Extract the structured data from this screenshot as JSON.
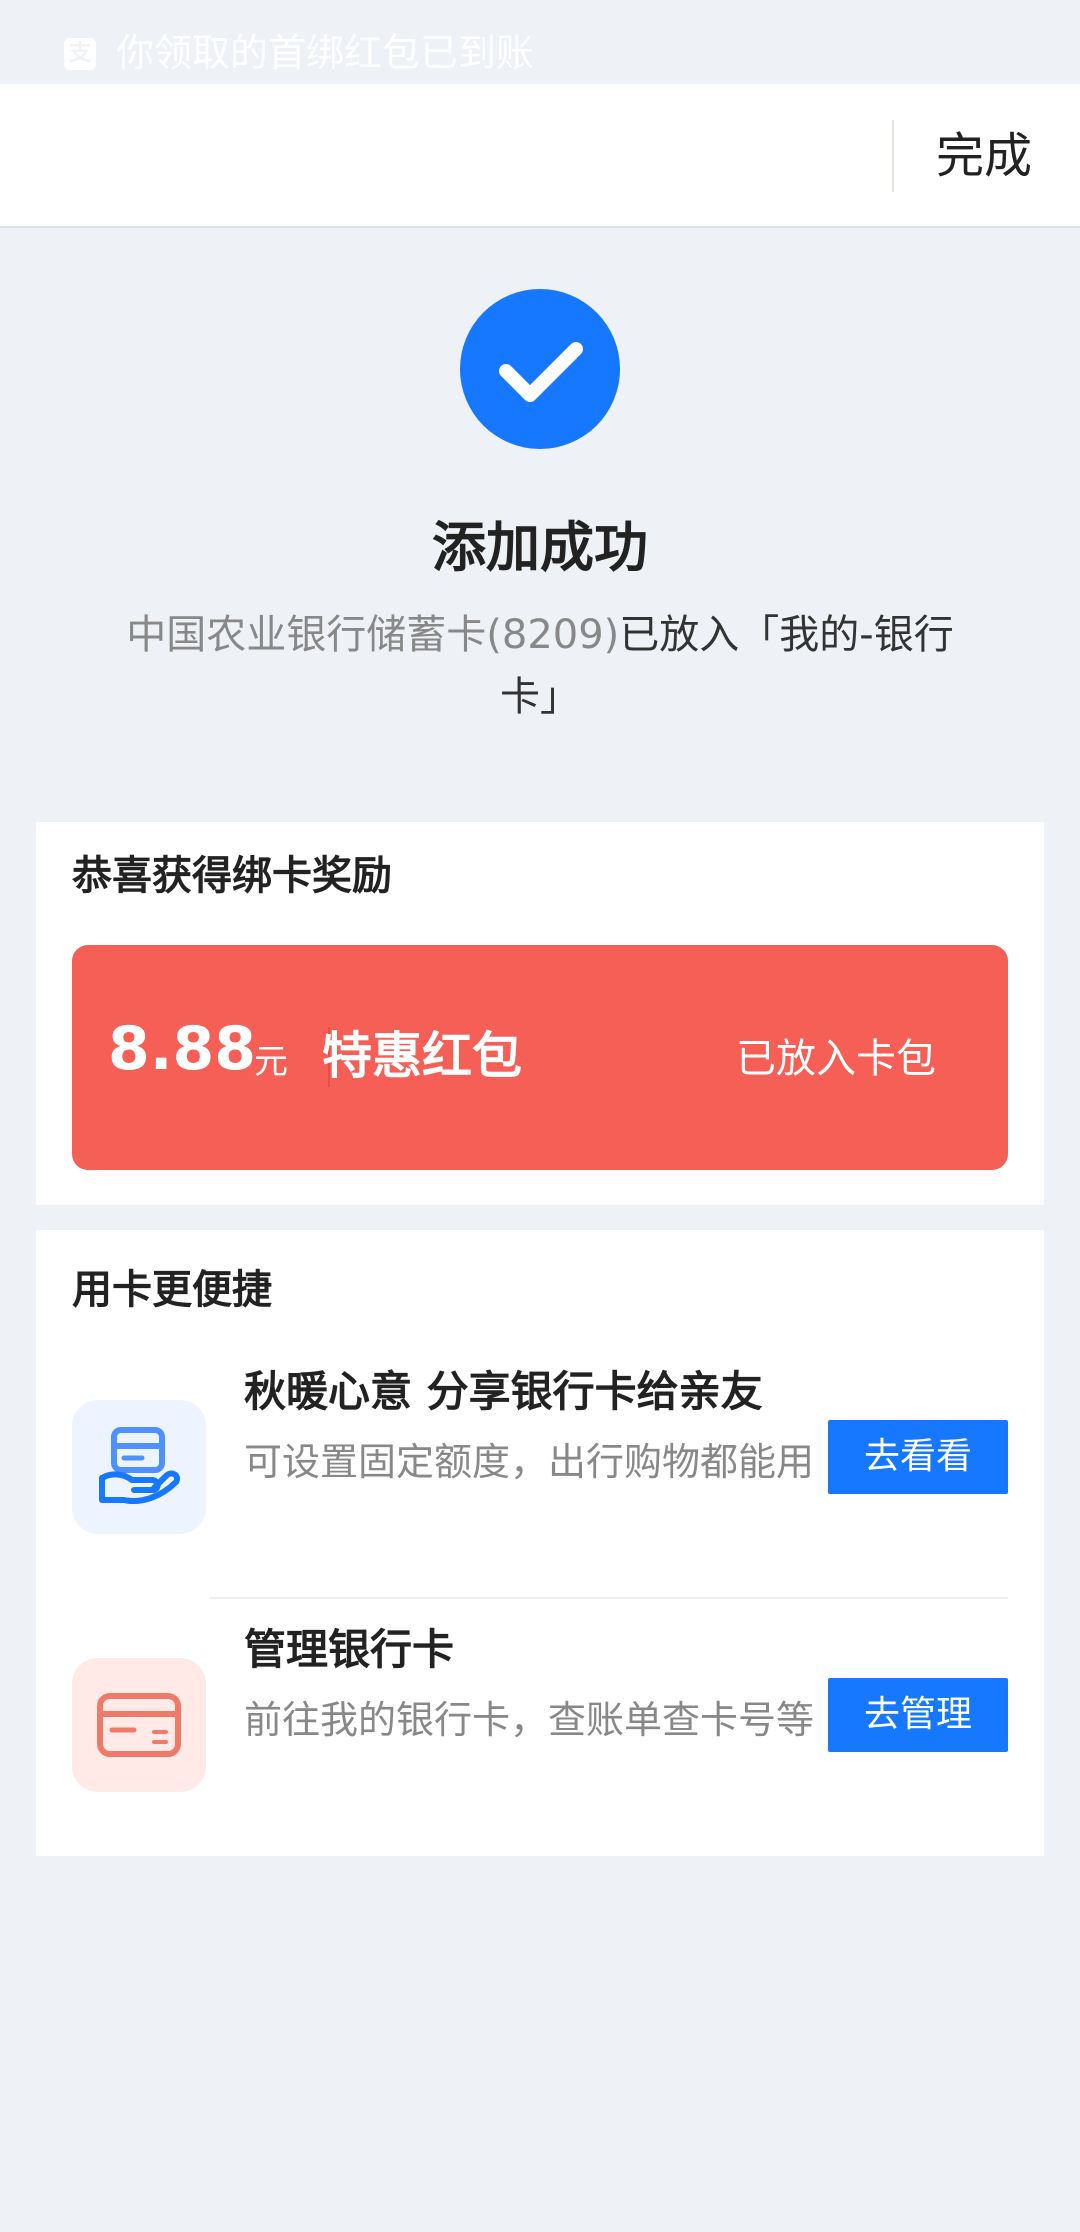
{
  "statusbar": {
    "notification_text": "你领取的首绑红包已到账",
    "notification_icon": "alipay-icon"
  },
  "navbar": {
    "done_label": "完成"
  },
  "success": {
    "icon": "check-icon",
    "title": "添加成功",
    "desc_prefix": "中国农业银行储蓄卡(8209)",
    "desc_suffix": "已放入「我的-银行卡」"
  },
  "reward": {
    "title": "恭喜获得绑卡奖励",
    "amount": "8.88",
    "unit": "元",
    "name": "特惠红包",
    "status": "已放入卡包",
    "color": "#f65f56"
  },
  "convenient": {
    "title": "用卡更便捷",
    "items": [
      {
        "icon": "hand-card-icon",
        "title": "秋暖心意 分享银行卡给亲友",
        "desc": "可设置固定额度，出行购物都能用",
        "button": "去看看"
      },
      {
        "icon": "bank-card-icon",
        "title": "管理银行卡",
        "desc": "前往我的银行卡，查账单查卡号等",
        "button": "去管理"
      }
    ]
  },
  "colors": {
    "accent": "#1677ff",
    "background": "#eef1f6"
  }
}
